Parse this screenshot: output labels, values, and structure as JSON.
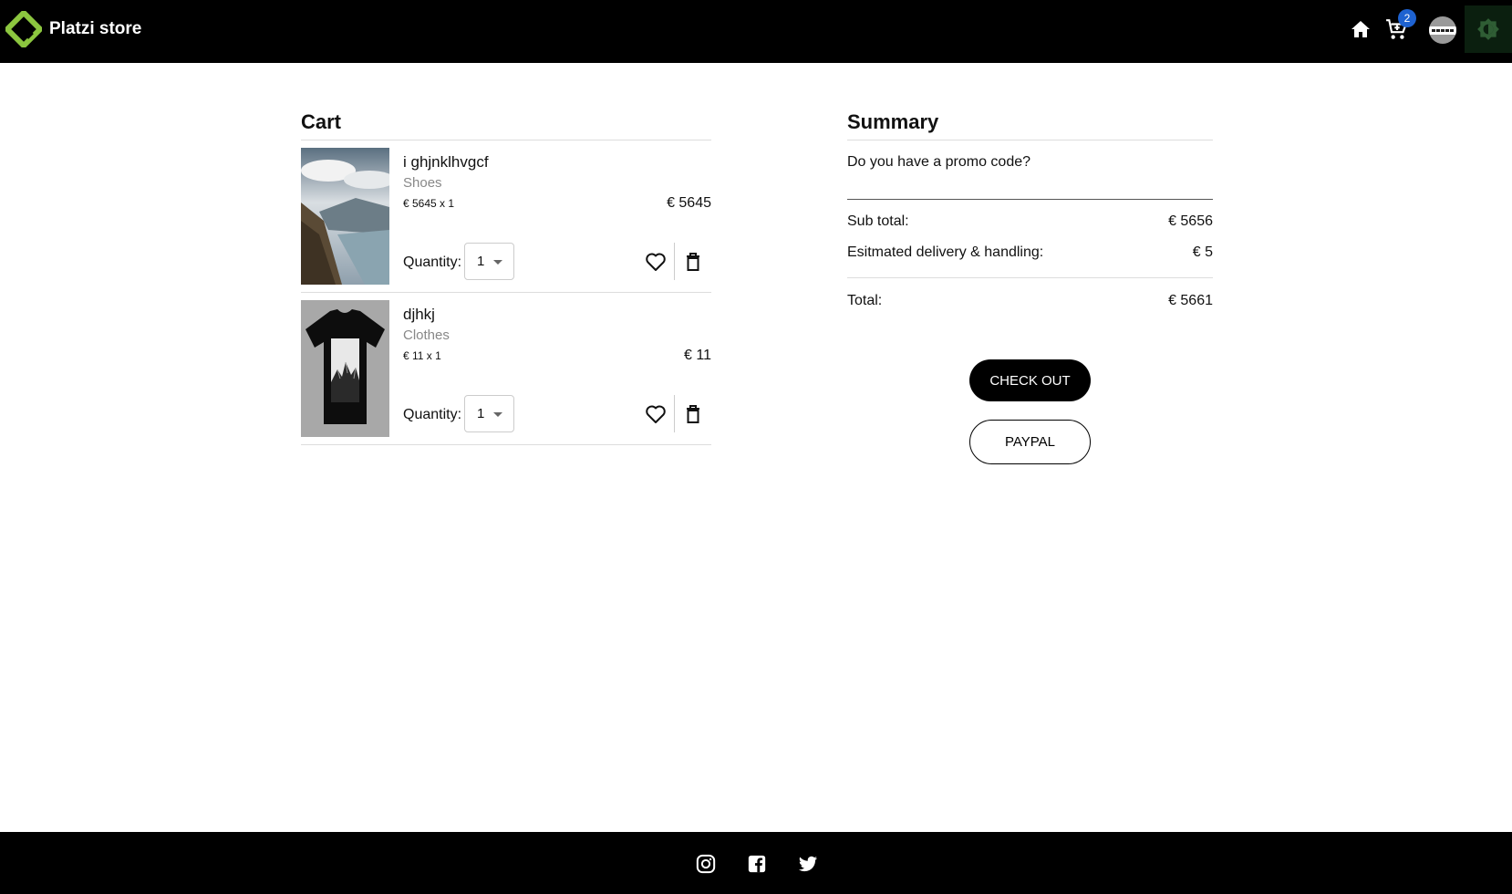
{
  "header": {
    "brand": "Platzi store",
    "cart_count": "2",
    "colors": {
      "background": "#000000",
      "logo": "#8cc63f",
      "badge": "#1e62d0"
    },
    "icons": [
      "home-icon",
      "shopping-cart-icon",
      "avatar",
      "theme-toggle-icon"
    ]
  },
  "cart": {
    "title": "Cart",
    "quantity_label": "Quantity:",
    "items": [
      {
        "name": "i ghjnklhvgcf",
        "category": "Shoes",
        "unit_line": "€ 5645 x 1",
        "price": "€ 5645",
        "quantity": "1",
        "image": "mountain-lake-photo"
      },
      {
        "name": "djhkj",
        "category": "Clothes",
        "unit_line": "€ 11 x 1",
        "price": "€ 11",
        "quantity": "1",
        "image": "black-tshirt-mountain-print"
      }
    ]
  },
  "summary": {
    "title": "Summary",
    "promo_prompt": "Do you have a promo code?",
    "subtotal_label": "Sub total:",
    "subtotal_value": "€ 5656",
    "delivery_label": "Esitmated delivery & handling:",
    "delivery_value": "€ 5",
    "total_label": "Total:",
    "total_value": "€ 5661",
    "checkout_label": "CHECK OUT",
    "paypal_label": "PAYPAL"
  },
  "footer": {
    "icons": [
      "instagram-icon",
      "facebook-icon",
      "twitter-icon"
    ]
  }
}
